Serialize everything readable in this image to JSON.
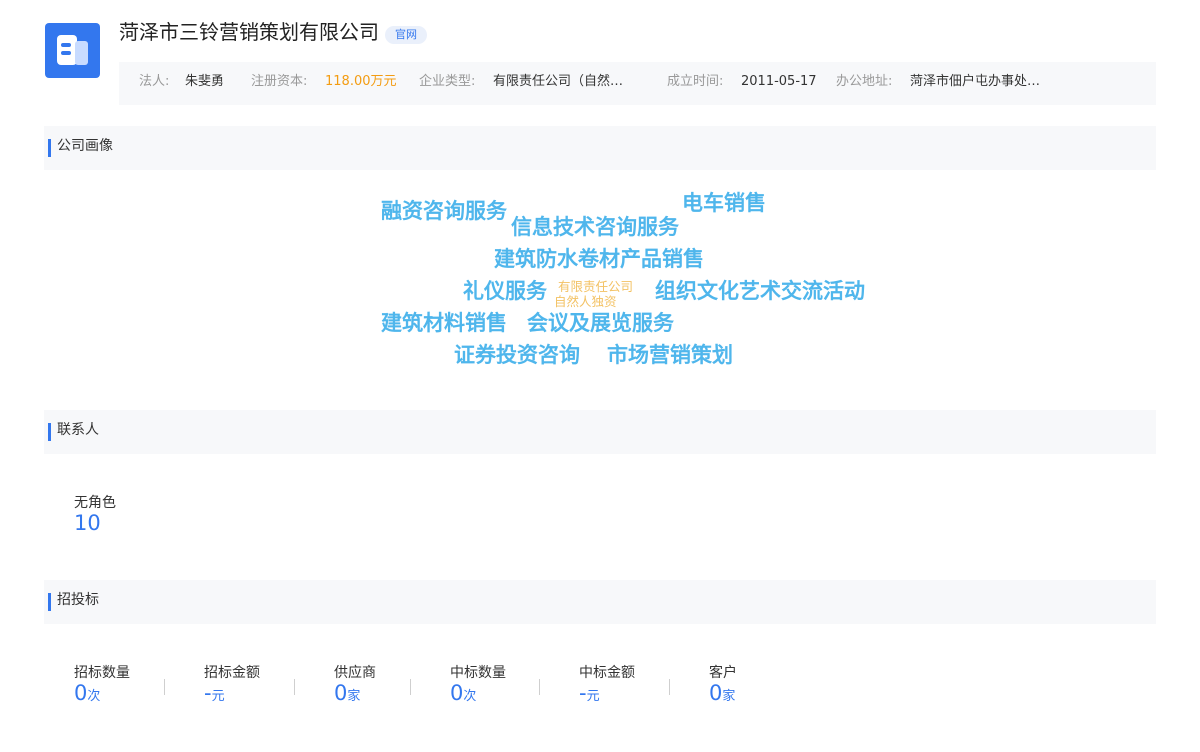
{
  "company": {
    "name": "菏泽市三铃营销策划有限公司",
    "badge": "官网",
    "logo_icon": "company-building-icon",
    "accent_color": "#3377ee"
  },
  "info": {
    "legal_label": "法人:",
    "legal_value": "朱斐勇",
    "capital_label": "注册资本:",
    "capital_value": "118.00万元",
    "type_label": "企业类型:",
    "type_value": "有限责任公司（自然…",
    "date_label": "成立时间:",
    "date_value": "2011-05-17",
    "address_label": "办公地址:",
    "address_value": "菏泽市佃户屯办事处…"
  },
  "portrait": {
    "title": "公司画像",
    "words": [
      "融资咨询服务",
      "电车销售",
      "信息技术咨询服务",
      "建筑防水卷材产品销售",
      "礼仪服务",
      "组织文化艺术交流活动",
      "建筑材料销售",
      "会议及展览服务",
      "证券投资咨询",
      "市场营销策划"
    ],
    "small_words": [
      "有限责任公司",
      "自然人独资"
    ],
    "word_color": "#4fb6ec",
    "small_word_color": "#f3c264"
  },
  "contacts": {
    "title": "联系人",
    "label": "无角色",
    "value": "10"
  },
  "bidding": {
    "title": "招投标",
    "stats": [
      {
        "label": "招标数量",
        "value": "0",
        "unit": "次"
      },
      {
        "label": "招标金额",
        "value": "-",
        "unit": "元"
      },
      {
        "label": "供应商",
        "value": "0",
        "unit": "家"
      },
      {
        "label": "中标数量",
        "value": "0",
        "unit": "次"
      },
      {
        "label": "中标金额",
        "value": "-",
        "unit": "元"
      },
      {
        "label": "客户",
        "value": "0",
        "unit": "家"
      }
    ]
  }
}
